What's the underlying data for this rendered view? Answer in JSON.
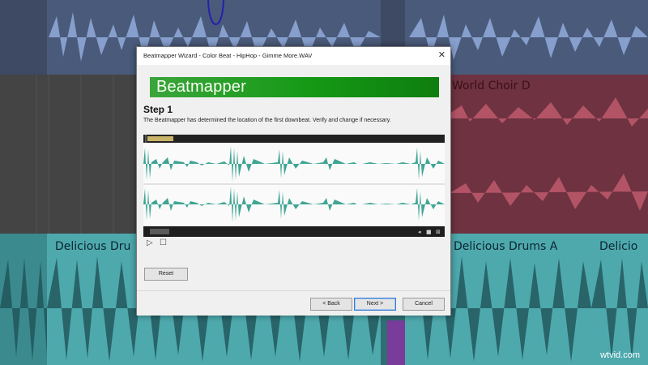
{
  "daw": {
    "clips": [
      {
        "label": "World Choir D",
        "color": "red"
      },
      {
        "label": "Delicious Dru",
        "color": "teal"
      },
      {
        "label": "Delicious Drums A",
        "color": "teal"
      },
      {
        "label": "Delicio",
        "color": "teal"
      }
    ]
  },
  "dialog": {
    "title": "Beatmapper Wizard - Color Beat - HipHop - Gimme More.WAV",
    "close_glyph": "✕",
    "banner_text": "Beatmapper",
    "step_title": "Step 1",
    "description": "The Beatmapper has determined the location of the first downbeat. Verify and change if necessary.",
    "play_glyph": "▷",
    "stop_glyph": "☐",
    "reset_label": "Reset",
    "back_label": "< Back",
    "next_label": "Next >",
    "cancel_label": "Cancel"
  },
  "watermark": "wtvid.com",
  "colors": {
    "accent_green": "#159a15",
    "wave_teal": "#3fa593",
    "marker_gold": "#c9b46a"
  },
  "icons": [
    "close-icon",
    "play-icon",
    "stop-icon"
  ]
}
